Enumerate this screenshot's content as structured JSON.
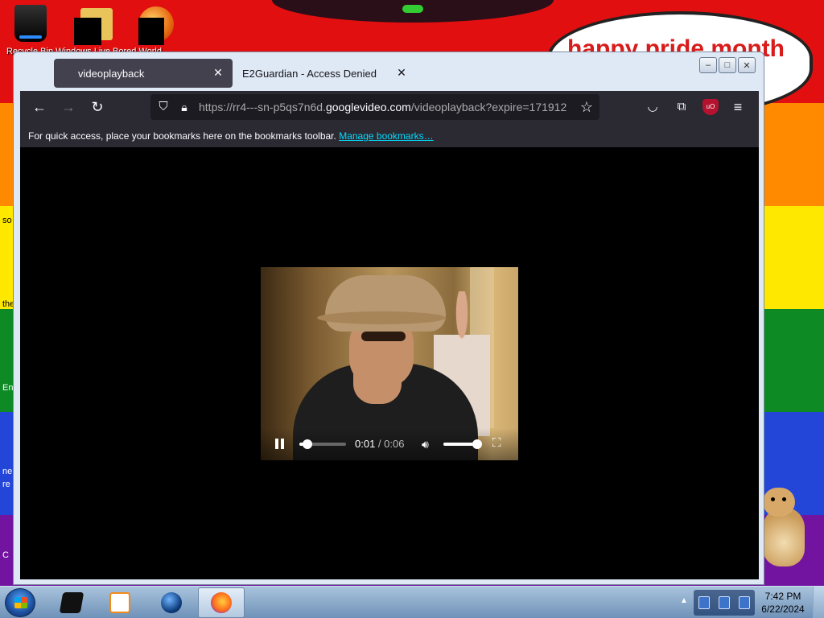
{
  "desktop": {
    "banner_text": "happy pride month",
    "icons": [
      {
        "label": "Recycle Bin",
        "icon": "recycle-bin-icon"
      },
      {
        "label": "Windows Live",
        "icon": "folder-icon"
      },
      {
        "label": "Bored World",
        "icon": "orb-icon"
      }
    ],
    "icon_labels_visible": "Recycle Bin   Windows Live   Bored World",
    "edge_fragments": [
      "so",
      "the",
      "En",
      "ne",
      "re",
      "C"
    ],
    "colors": {
      "red": "#e10f0f",
      "orange": "#ff8a00",
      "yellow": "#ffe800",
      "green": "#0d8a24",
      "blue": "#2346d8",
      "purple": "#7214a0"
    }
  },
  "browser": {
    "tabs": [
      {
        "label": "videoplayback",
        "active": true,
        "close": "✕"
      },
      {
        "label": "E2Guardian - Access Denied",
        "active": false,
        "close": "✕"
      }
    ],
    "window_buttons": {
      "minimize": "–",
      "maximize": "□",
      "close": "✕"
    },
    "url": {
      "prefix": "https://rr4---sn-p5qs7n6d.",
      "host": "googlevideo.com",
      "suffix": "/videoplayback?expire=171912"
    },
    "nav_icons": [
      "back-icon",
      "forward-icon",
      "reload-icon",
      "shield-icon",
      "lock-icon",
      "bookmark-star-icon",
      "pocket-icon",
      "extensions-icon",
      "ublock-icon",
      "menu-icon"
    ],
    "bookmarks_bar": {
      "text": "For quick access, place your bookmarks here on the bookmarks toolbar.",
      "link": "Manage bookmarks…"
    },
    "ublock_badge": "uO"
  },
  "video": {
    "current_time": "0:01",
    "separator": " / ",
    "duration": "0:06",
    "progress": 0.17,
    "volume": 0.92,
    "state": "playing"
  },
  "taskbar": {
    "apps": [
      "media-app",
      "media-player",
      "globe-browser",
      "firefox"
    ],
    "time": "7:42 PM",
    "date": "6/22/2024",
    "tray_arrow": "▲"
  }
}
